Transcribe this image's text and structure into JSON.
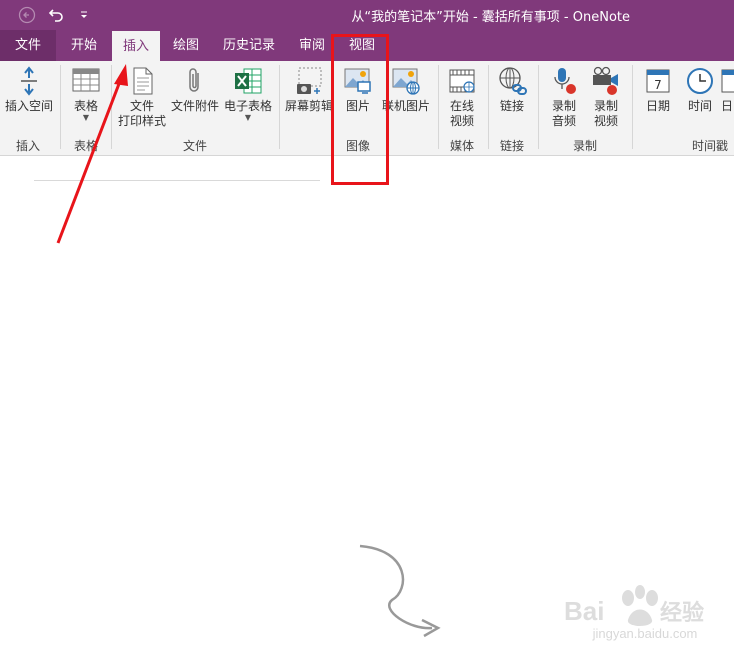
{
  "window": {
    "title": "从“我的笔记本”开始 - 囊括所有事项  -  OneNote"
  },
  "quick_access": {
    "back_icon": "back-arrow-icon",
    "undo_icon": "undo-icon",
    "customize_icon": "customize-quick-access-icon"
  },
  "tabs": [
    {
      "label": "文件",
      "active": false
    },
    {
      "label": "开始",
      "active": false
    },
    {
      "label": "插入",
      "active": true
    },
    {
      "label": "绘图",
      "active": false
    },
    {
      "label": "历史记录",
      "active": false
    },
    {
      "label": "审阅",
      "active": false
    },
    {
      "label": "视图",
      "active": false
    }
  ],
  "ribbon": {
    "groups": [
      {
        "label": "插入"
      },
      {
        "label": "表格"
      },
      {
        "label": "文件"
      },
      {
        "label": "图像"
      },
      {
        "label": "媒体"
      },
      {
        "label": "链接"
      },
      {
        "label": "录制"
      },
      {
        "label": "时间戳"
      }
    ],
    "commands": {
      "insert_space": "插入空间",
      "table": "表格",
      "file_printout_1": "文件",
      "file_printout_2": "打印样式",
      "file_attachment": "文件附件",
      "spreadsheet": "电子表格",
      "screen_clipping": "屏幕剪辑",
      "picture": "图片",
      "online_picture": "联机图片",
      "online_video_1": "在线",
      "online_video_2": "视频",
      "link": "链接",
      "record_audio_1": "录制",
      "record_audio_2": "音频",
      "record_video_1": "录制",
      "record_video_2": "视频",
      "date": "日期",
      "time": "时间",
      "date_time": "日"
    }
  },
  "colors": {
    "brand": "#80397b",
    "ribbon_bg": "#f3f3f3",
    "annotation_red": "#e8141a"
  },
  "watermark": {
    "text": "Baidu经验",
    "url": "jingyan.baidu.com"
  }
}
